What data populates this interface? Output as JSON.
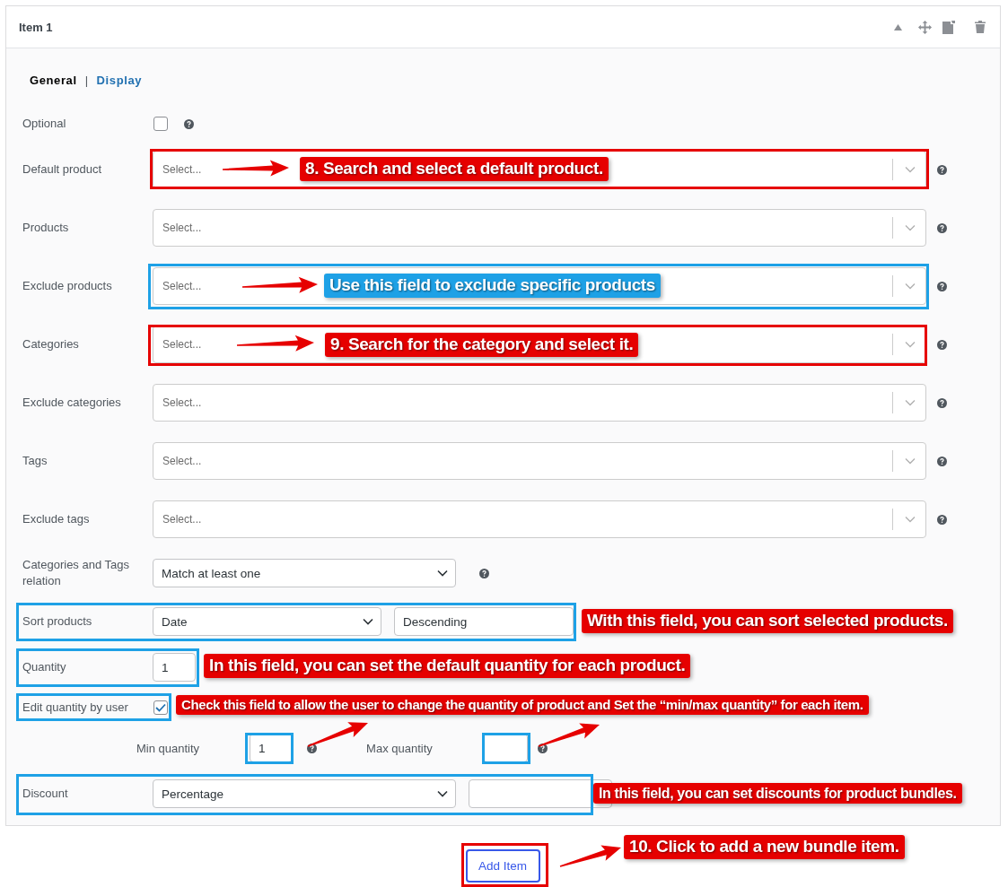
{
  "item": {
    "title": "Item 1"
  },
  "tabs": [
    {
      "label": "General",
      "selected": true
    },
    {
      "label": "Display",
      "selected": false
    }
  ],
  "tab_separator": "|",
  "rows": [
    {
      "kind": "checkbox",
      "label": "Optional",
      "checked": false,
      "help": true
    },
    {
      "kind": "search-select",
      "label": "Default product",
      "placeholder": "Select...",
      "help": true
    },
    {
      "kind": "search-select",
      "label": "Products",
      "placeholder": "Select...",
      "help": true
    },
    {
      "kind": "search-select",
      "label": "Exclude products",
      "placeholder": "Select...",
      "help": true
    },
    {
      "kind": "search-select",
      "label": "Categories",
      "placeholder": "Select...",
      "help": true
    },
    {
      "kind": "search-select",
      "label": "Exclude categories",
      "placeholder": "Select...",
      "help": true
    },
    {
      "kind": "search-select",
      "label": "Tags",
      "placeholder": "Select...",
      "help": true
    },
    {
      "kind": "search-select",
      "label": "Exclude tags",
      "placeholder": "Select...",
      "help": true
    },
    {
      "kind": "dropdown",
      "label": "Categories and Tags relation",
      "value": "Match at least one",
      "help": true
    },
    {
      "kind": "sort",
      "label": "Sort products",
      "value": "Date",
      "order": "Descending"
    },
    {
      "kind": "number",
      "label": "Quantity",
      "value": "1"
    },
    {
      "kind": "checkbox",
      "label": "Edit quantity by user",
      "checked": true,
      "help": false
    },
    {
      "kind": "minmax",
      "min_label": "Min quantity",
      "min_value": "1",
      "max_label": "Max quantity"
    },
    {
      "kind": "discount",
      "label": "Discount",
      "value": "Percentage"
    }
  ],
  "add_button": "Add Item",
  "frames": [
    {
      "color": "#e60000"
    },
    {
      "color": "#1ea1e6"
    },
    {
      "color": "#e60000"
    },
    {
      "color": "#1ea1e6"
    },
    {
      "color": "#1ea1e6"
    },
    {
      "color": "#1ea1e6"
    },
    {
      "color": "#1ea1e6"
    },
    {
      "color": "#1ea1e6"
    },
    {
      "color": "#1ea1e6"
    },
    {
      "color": "#e60000"
    }
  ],
  "annotations": [
    {
      "text": "8. Search and select a default product.",
      "color": "#e60000"
    },
    {
      "text": "Use this field to exclude specific products",
      "color": "#1ea1e6"
    },
    {
      "text": "9. Search for the category and select it.",
      "color": "#e60000"
    },
    {
      "text": "With this field, you can sort selected products.",
      "color": "#e60000"
    },
    {
      "text": "In this field, you can set the default quantity for each product.",
      "color": "#e60000"
    },
    {
      "text": "Check this field to allow the user to change the quantity of product and Set the “min/max quantity” for each item.",
      "color": "#e60000"
    },
    {
      "text": "In this field, you can set discounts for product bundles.",
      "color": "#e60000"
    },
    {
      "text": "10. Click to add a new bundle item.",
      "color": "#e60000"
    }
  ]
}
